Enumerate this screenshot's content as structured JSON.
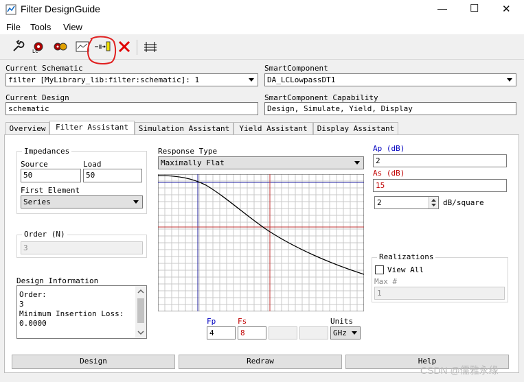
{
  "window": {
    "title": "Filter DesignGuide",
    "minimize": "—",
    "maximize": "☐",
    "close": "✕"
  },
  "menu": {
    "file": "File",
    "tools": "Tools",
    "view": "View"
  },
  "toolbar": {
    "icons": [
      "wrench-icon",
      "gear-red-icon",
      "gear-multi-icon",
      "graph-icon",
      "component-insert-icon",
      "delete-icon",
      "grid-icon"
    ]
  },
  "schematic": {
    "label": "Current Schematic",
    "value": "filter [MyLibrary_lib:filter:schematic]: 1"
  },
  "smart_component": {
    "label": "SmartComponent",
    "value": "DA_LCLowpassDT1"
  },
  "design": {
    "label": "Current Design",
    "value": "schematic"
  },
  "capability": {
    "label": "SmartComponent Capability",
    "value": "Design, Simulate, Yield, Display"
  },
  "tabs": [
    "Overview",
    "Filter Assistant",
    "Simulation Assistant",
    "Yield Assistant",
    "Display Assistant"
  ],
  "impedances": {
    "title": "Impedances",
    "source_label": "Source",
    "source_value": "50",
    "load_label": "Load",
    "load_value": "50"
  },
  "first_element": {
    "label": "First Element",
    "value": "Series"
  },
  "order": {
    "label": "Order (N)",
    "value": "3"
  },
  "design_info": {
    "label": "Design Information",
    "lines": [
      "Order:",
      "3",
      "",
      "Minimum Insertion Loss:",
      "0.0000"
    ]
  },
  "response": {
    "label": "Response Type",
    "value": "Maximally Flat"
  },
  "ap": {
    "label": "Ap (dB)",
    "value": "2"
  },
  "as": {
    "label": "As (dB)",
    "value": "15"
  },
  "slope": {
    "value": "2",
    "unit": "dB/square"
  },
  "realizations": {
    "title": "Realizations",
    "view_all": "View All",
    "max_label": "Max #",
    "max_value": "1"
  },
  "freq": {
    "fp_label": "Fp",
    "fp_value": "4",
    "fs_label": "Fs",
    "fs_value": "8",
    "units_label": "Units",
    "units_value": "GHz"
  },
  "buttons": {
    "design": "Design",
    "redraw": "Redraw",
    "help": "Help"
  },
  "watermark": "CSDN @儒雅永缘",
  "colors": {
    "accent_red": "#c00000",
    "accent_blue": "#0000c0",
    "annotation": "#e02020"
  }
}
